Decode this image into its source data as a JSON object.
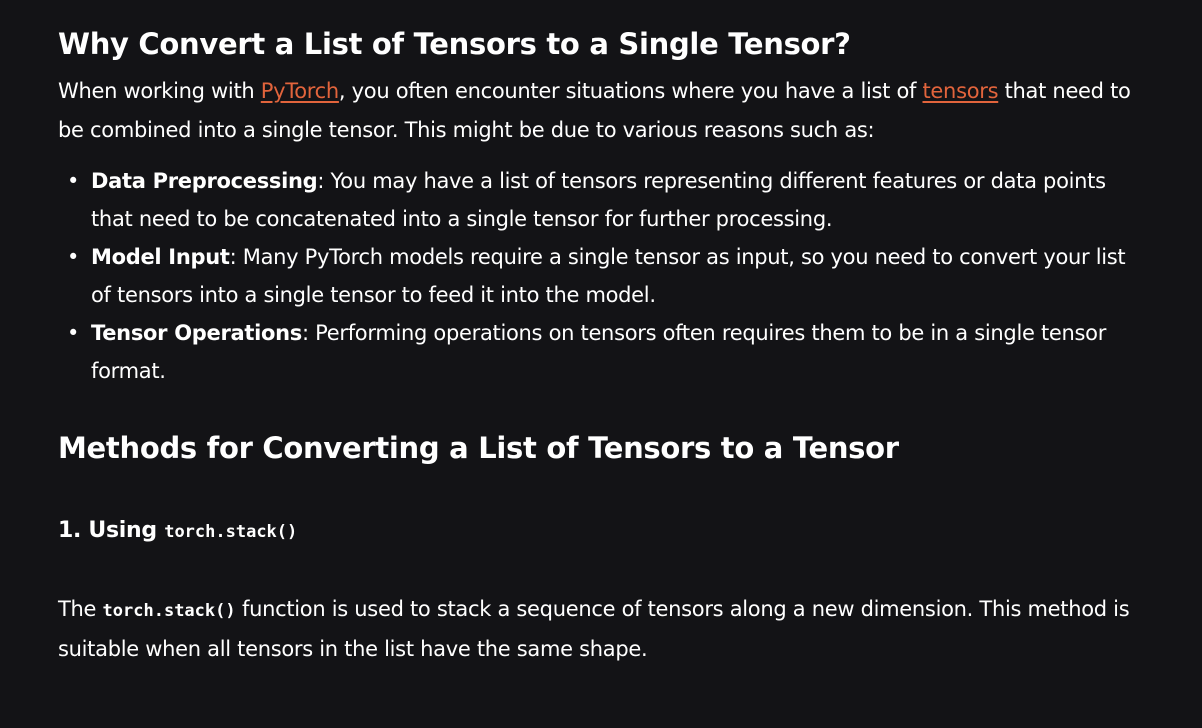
{
  "section1": {
    "heading": "Why Convert a List of Tensors to a Single Tensor?",
    "intro": {
      "part1": "When working with ",
      "link1": "PyTorch",
      "part2": ", you often encounter situations where you have a list of ",
      "link2": "tensors",
      "part3": " that need to be combined into a single tensor. This might be due to various reasons such as:"
    },
    "bullets": [
      {
        "term": "Data Preprocessing",
        "text": ": You may have a list of tensors representing different features or data points that need to be concatenated into a single tensor for further processing."
      },
      {
        "term": "Model Input",
        "text": ": Many PyTorch models require a single tensor as input, so you need to convert your list of tensors into a single tensor to feed it into the model."
      },
      {
        "term": "Tensor Operations",
        "text": ": Performing operations on tensors often requires them to be in a single tensor format."
      }
    ]
  },
  "section2": {
    "heading": "Methods for Converting a List of Tensors to a Tensor",
    "subheading": {
      "prefix": "1. Using ",
      "code": "torch.stack()"
    },
    "body": {
      "part1": "The ",
      "code": "torch.stack()",
      "part2": " function is used to stack a sequence of tensors along a new dimension. This method is suitable when all tensors in the list have the same shape."
    }
  },
  "colors": {
    "background": "#131316",
    "text": "#ffffff",
    "link": "#e2643c"
  }
}
